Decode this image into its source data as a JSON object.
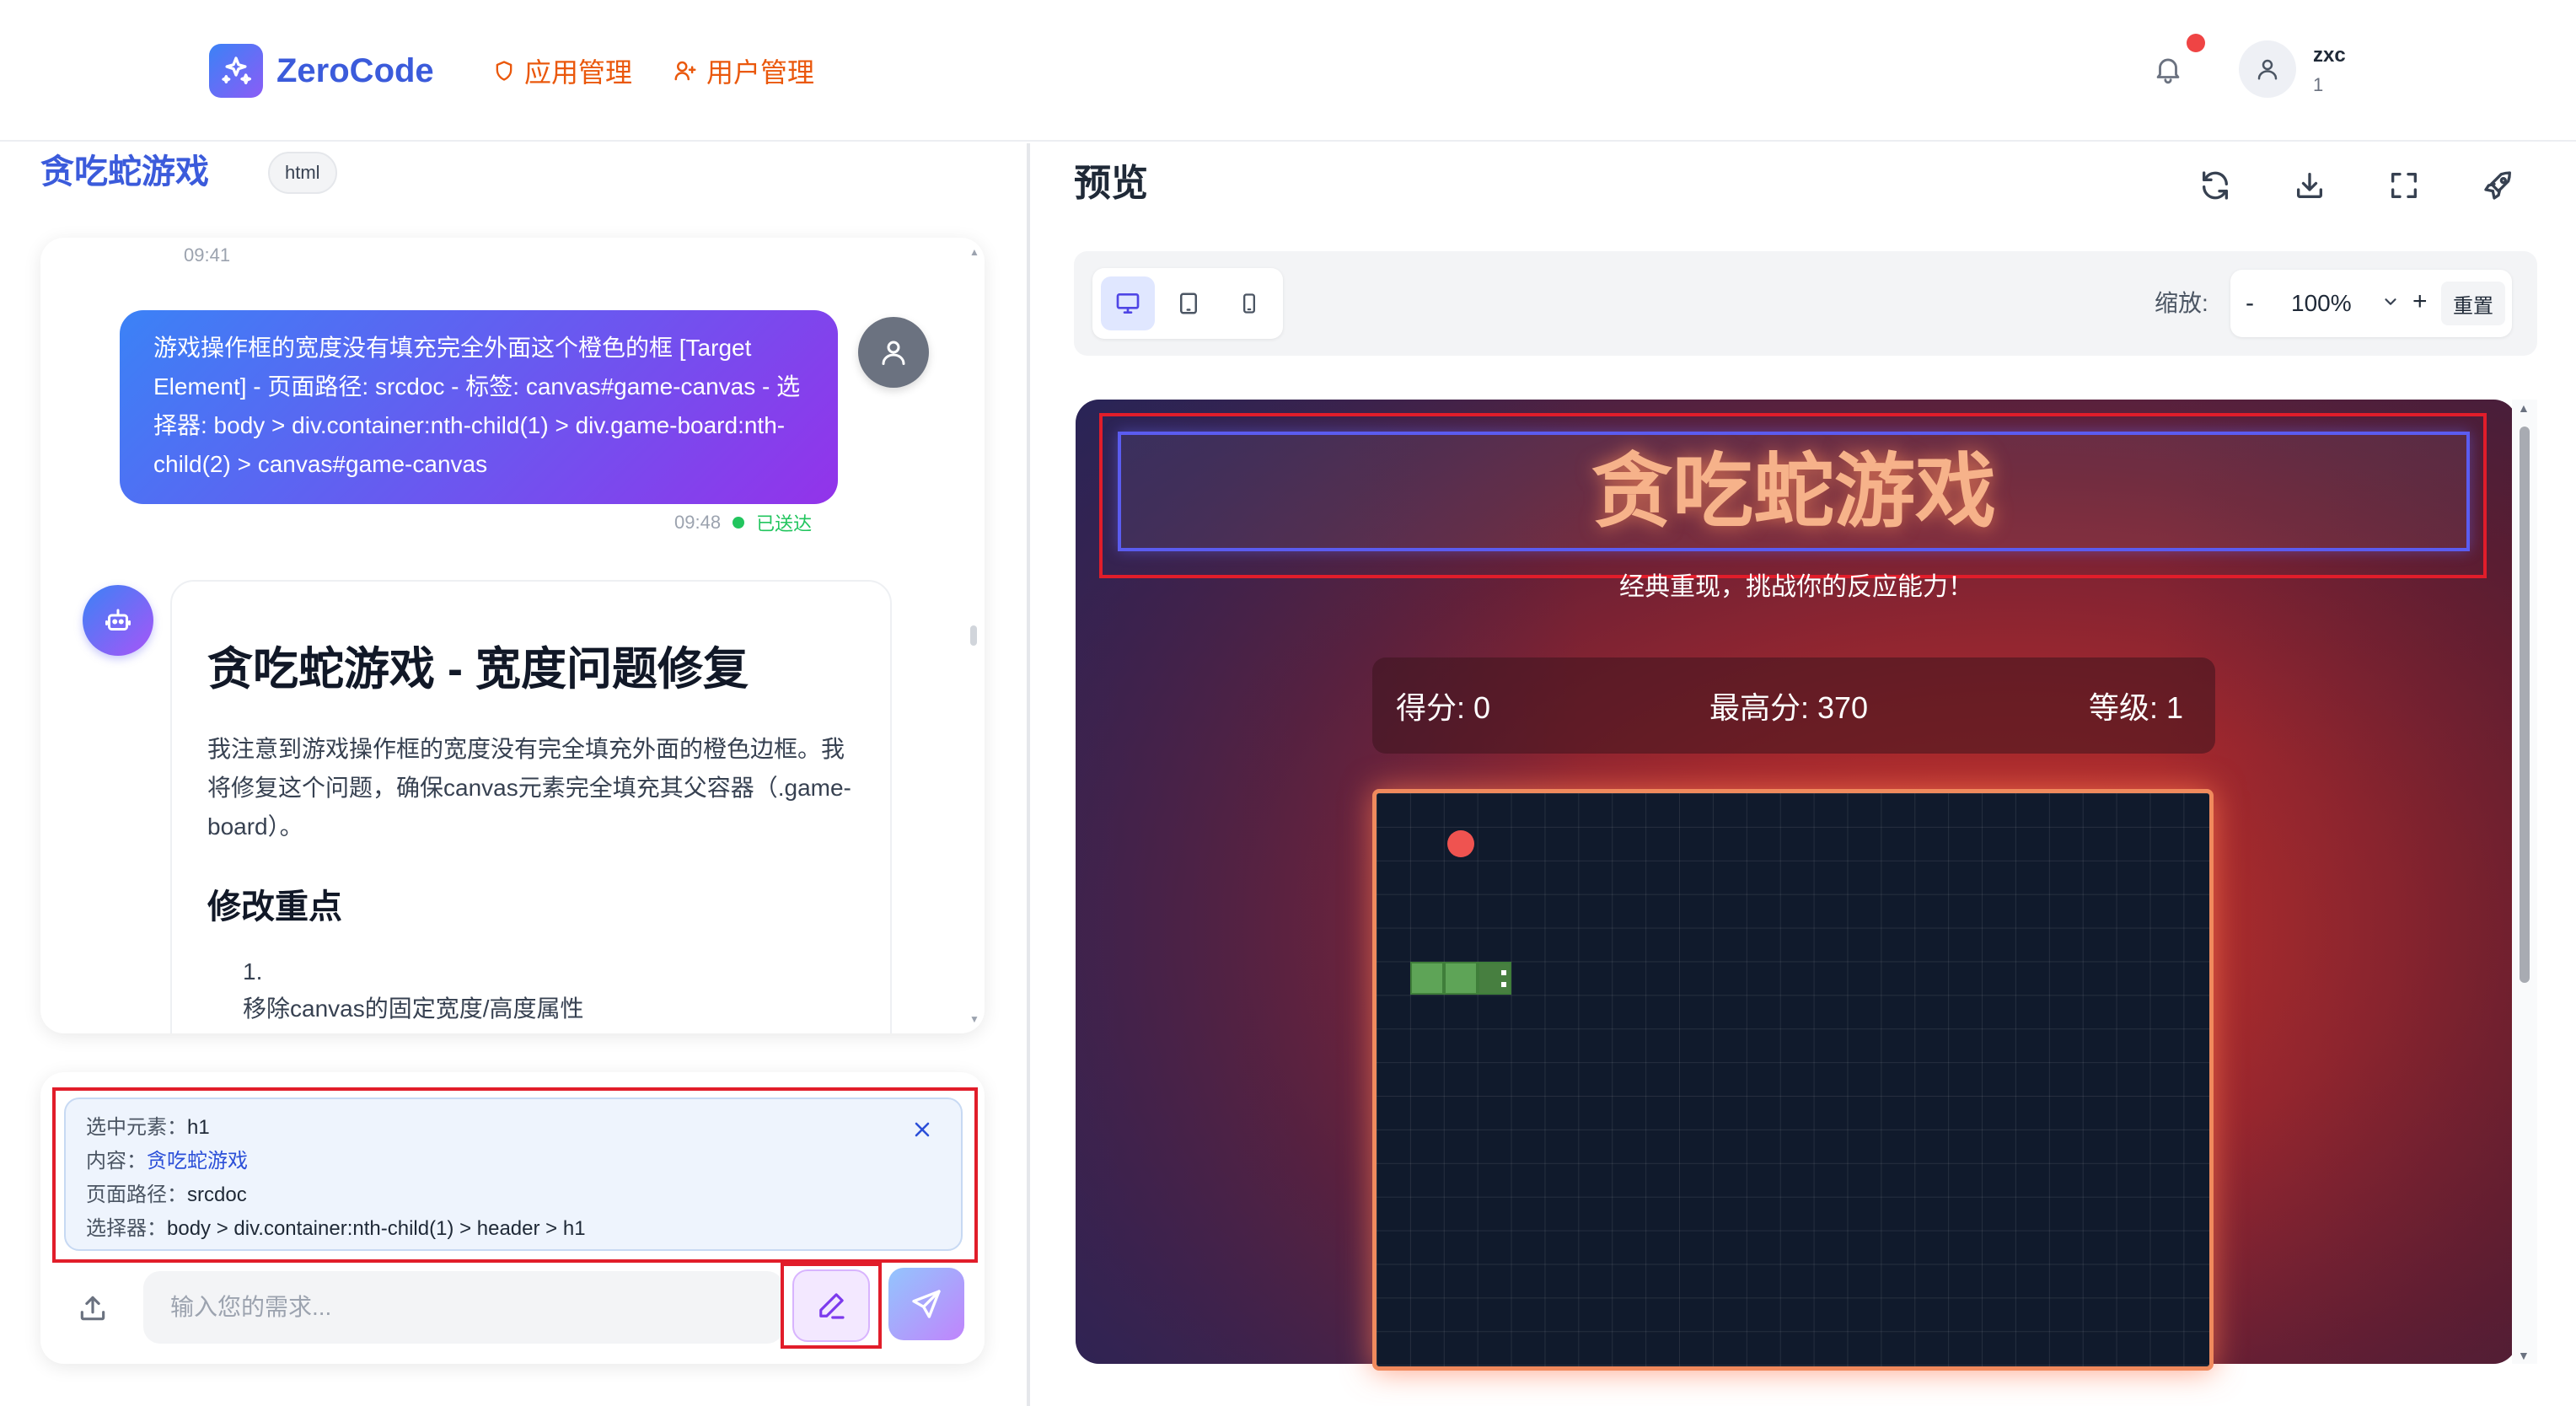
{
  "app": {
    "name": "ZeroCode",
    "nav": [
      {
        "label": "应用管理",
        "icon": "shield-icon"
      },
      {
        "label": "用户管理",
        "icon": "users-icon"
      }
    ],
    "user": {
      "name": "zxc",
      "sub": "1"
    }
  },
  "left": {
    "title": "贪吃蛇游戏",
    "tag": "html",
    "chat": {
      "top_time": "09:41",
      "user_message": {
        "text": "游戏操作框的宽度没有填充完全外面这个橙色的框 [Target Element] - 页面路径: srcdoc - 标签: canvas#game-canvas - 选择器: body > div.container:nth-child(1) > div.game-board:nth-child(2) > canvas#game-canvas",
        "time": "09:48",
        "status": "已送达"
      },
      "bot_message": {
        "heading": "贪吃蛇游戏 - 宽度问题修复",
        "paragraph": "我注意到游戏操作框的宽度没有完全填充外面的橙色边框。我将修复这个问题，确保canvas元素完全填充其父容器（.game-board）。",
        "subheading": "修改重点",
        "list_number": "1.",
        "list_item": "移除canvas的固定宽度/高度属性"
      }
    },
    "selection": {
      "element_label": "选中元素：",
      "element_value": "h1",
      "content_label": "内容：",
      "content_value": "贪吃蛇游戏",
      "path_label": "页面路径：",
      "path_value": "srcdoc",
      "selector_label": "选择器：",
      "selector_value": "body > div.container:nth-child(1) > header > h1"
    },
    "input": {
      "placeholder": "输入您的需求..."
    }
  },
  "preview": {
    "title": "预览",
    "tools": [
      "refresh-icon",
      "download-icon",
      "fullscreen-icon",
      "rocket-icon"
    ],
    "devices": [
      "desktop-icon",
      "tablet-icon",
      "mobile-icon"
    ],
    "active_device": "desktop",
    "zoom": {
      "label": "缩放:",
      "minus": "-",
      "value": "100%",
      "plus": "+",
      "reset": "重置"
    },
    "game": {
      "title": "贪吃蛇游戏",
      "subtitle": "经典重现，挑战你的反应能力！",
      "score": "得分: 0",
      "high_score": "最高分: 370",
      "level": "等级: 1",
      "grid": {
        "cols": 25,
        "rows": 18
      },
      "food": {
        "col": 2,
        "row": 1
      },
      "snake": [
        {
          "col": 3,
          "row": 5
        },
        {
          "col": 2,
          "row": 5
        },
        {
          "col": 1,
          "row": 5
        }
      ]
    }
  },
  "colors": {
    "brand": "#3b5bdb",
    "accent_orange": "#ea580c",
    "highlight_red": "#e11d2a",
    "status_green": "#22c55e"
  }
}
